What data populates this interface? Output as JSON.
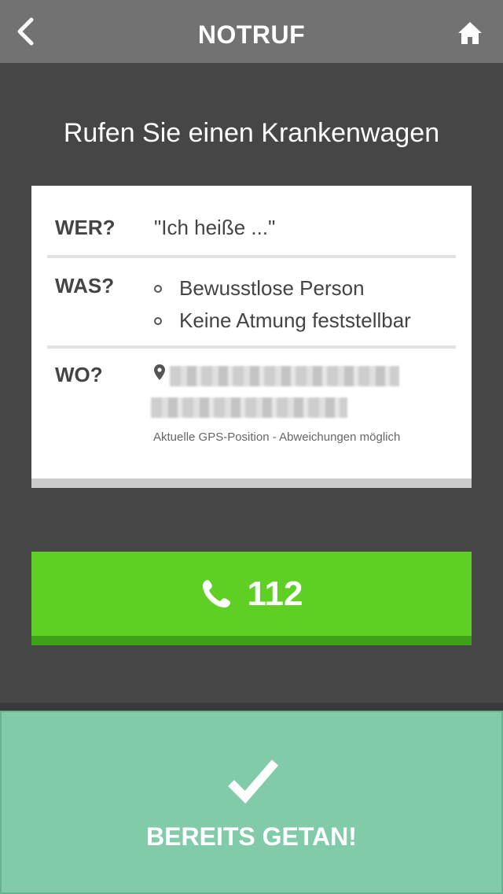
{
  "header": {
    "title": "NOTRUF",
    "back_icon": "chevron-left-icon",
    "home_icon": "home-icon"
  },
  "heading": "Rufen Sie einen Krankenwagen",
  "card": {
    "wer": {
      "label": "WER?",
      "value": "\"Ich heiße ...\""
    },
    "was": {
      "label": "WAS?",
      "items": [
        "Bewusstlose Person",
        "Keine Atmung feststellbar"
      ]
    },
    "wo": {
      "label": "WO?",
      "pin_icon": "map-pin-icon",
      "gps_note": "Aktuelle GPS-Position - Abweichungen möglich"
    }
  },
  "call_button": {
    "number": "112",
    "icon": "phone-icon"
  },
  "done_button": {
    "label": "BEREITS GETAN!",
    "icon": "checkmark-icon"
  },
  "colors": {
    "header_bg": "#727272",
    "page_bg": "#464646",
    "call_green": "#5fcf24",
    "done_green": "#82cba8"
  }
}
